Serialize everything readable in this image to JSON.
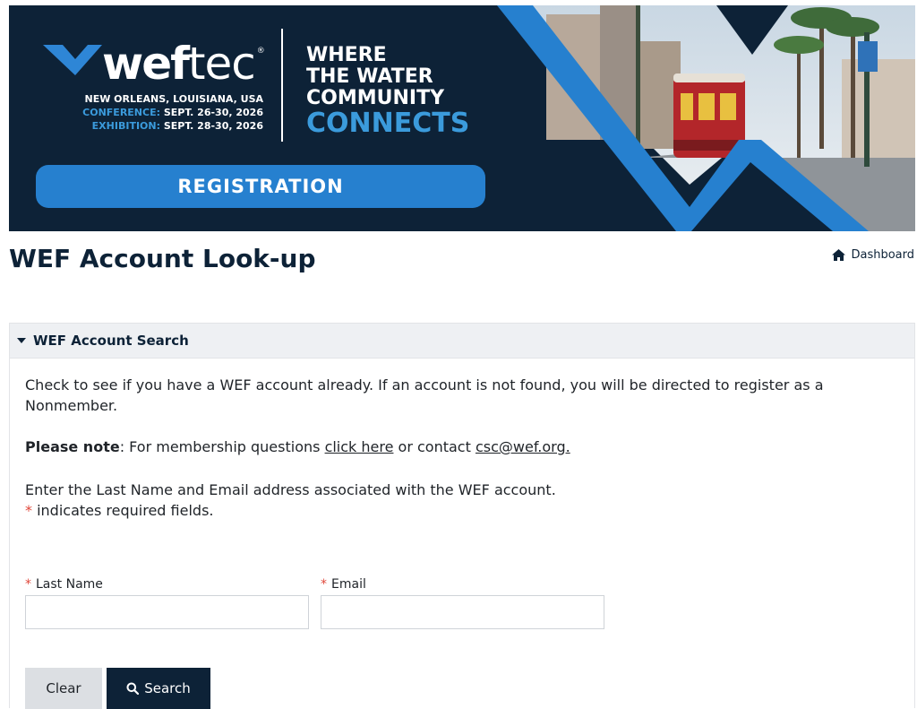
{
  "banner": {
    "logo_bold": "wef",
    "logo_light": "tec",
    "logo_reg": "®",
    "location": "NEW ORLEANS, LOUISIANA, USA",
    "conference_label": "CONFERENCE:",
    "conference_dates": "SEPT. 26-30, 2026",
    "exhibition_label": "EXHIBITION:",
    "exhibition_dates": "SEPT. 28-30, 2026",
    "tagline_1": "WHERE",
    "tagline_2": "THE WATER",
    "tagline_3": "COMMUNITY",
    "tagline_4": "CONNECTS",
    "registration_label": "REGISTRATION"
  },
  "header": {
    "title": "WEF Account Look-up",
    "dashboard_label": "Dashboard"
  },
  "panel": {
    "title": "WEF Account Search",
    "intro": "Check to see if you have a WEF account already. If an account is not found, you will be directed to register as a Nonmember.",
    "note_label": "Please note",
    "note_text_1": ": For membership questions ",
    "note_link": "click here",
    "note_text_2": " or contact ",
    "note_email": "csc@wef.org.",
    "instructions": "Enter the Last Name and Email address associated with the WEF account.",
    "required_marker": "*",
    "required_text": " indicates required fields."
  },
  "form": {
    "last_name_label": "Last Name",
    "last_name_value": "",
    "email_label": "Email",
    "email_value": "",
    "clear_label": "Clear",
    "search_label": "Search"
  },
  "colors": {
    "navy": "#0d2237",
    "accent_blue": "#2680cf",
    "required_red": "#e0483b"
  }
}
